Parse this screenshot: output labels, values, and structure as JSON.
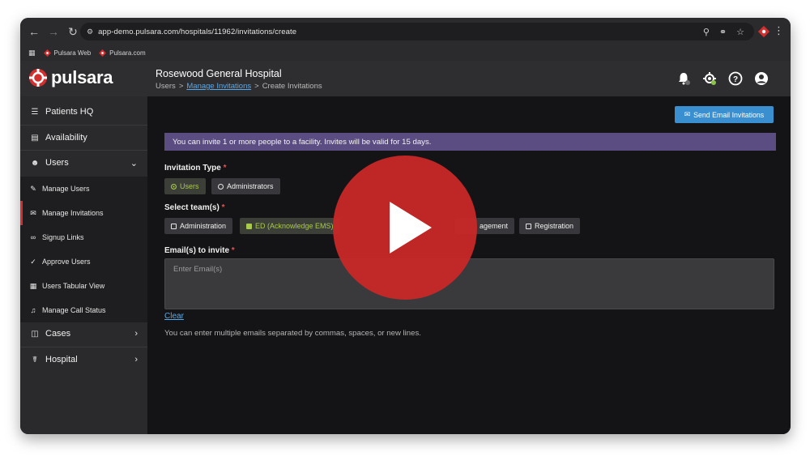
{
  "browser": {
    "url": "app-demo.pulsara.com/hospitals/11962/invitations/create",
    "bookmarks": [
      {
        "label": "Pulsara Web",
        "icon": "pulsara-icon"
      },
      {
        "label": "Pulsara.com",
        "icon": "pulsara-icon"
      }
    ],
    "accent": "#d32f2f"
  },
  "app": {
    "logo_text": "pulsara",
    "hospital_name": "Rosewood General Hospital",
    "breadcrumb": {
      "root": "Users",
      "sep1": ">",
      "link": "Manage Invitations",
      "sep2": ">",
      "current": "Create Invitations"
    }
  },
  "sidebar": {
    "items": [
      {
        "label": "Patients HQ",
        "icon": "list-icon"
      },
      {
        "label": "Availability",
        "icon": "bed-icon"
      },
      {
        "label": "Users",
        "icon": "users-icon",
        "expanded": true
      },
      {
        "label": "Cases",
        "icon": "cases-icon"
      },
      {
        "label": "Hospital",
        "icon": "hospital-icon"
      }
    ],
    "sub_items": [
      {
        "label": "Manage Users",
        "icon": "edit-icon"
      },
      {
        "label": "Manage Invitations",
        "icon": "envelope-icon",
        "active": true
      },
      {
        "label": "Signup Links",
        "icon": "link-icon"
      },
      {
        "label": "Approve Users",
        "icon": "check-icon"
      },
      {
        "label": "Users Tabular View",
        "icon": "table-icon"
      },
      {
        "label": "Manage Call Status",
        "icon": "bell-icon"
      }
    ]
  },
  "main": {
    "send_button": "Send Email Invitations",
    "banner": "You can invite 1 or more people to a facility. Invites will be valid for 15 days.",
    "invitation_type": {
      "label": "Invitation Type",
      "required": "*",
      "options": [
        {
          "label": "Users",
          "selected": true
        },
        {
          "label": "Administrators",
          "selected": false
        }
      ]
    },
    "teams": {
      "label": "Select team(s)",
      "required": "*",
      "options": [
        {
          "label": "Administration",
          "checked": false
        },
        {
          "label": "ED (Acknowledge EMS)",
          "checked": true
        },
        {
          "label": "agement",
          "checked": false
        },
        {
          "label": "Registration",
          "checked": false
        }
      ]
    },
    "emails": {
      "label": "Email(s) to invite",
      "required": "*",
      "placeholder": "Enter Email(s)",
      "clear": "Clear",
      "help": "You can enter multiple emails separated by commas, spaces, or new lines."
    }
  },
  "colors": {
    "banner": "#5b4d82",
    "button": "#3a8fd0",
    "selected_green": "#a9c94a",
    "play_red": "#c82828"
  }
}
